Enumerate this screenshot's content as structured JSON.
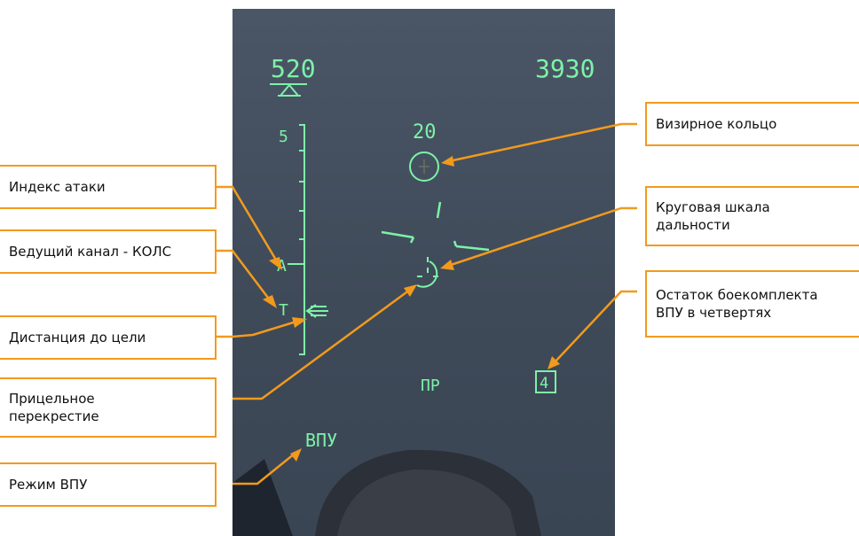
{
  "hud": {
    "speed": "520",
    "altitude": "3930",
    "range_scale_top": "5",
    "ring_value": "20",
    "attack_index_mark": "A",
    "lead_channel_mark": "T",
    "mode_center": "ПР",
    "ammo_quarters": "4",
    "mode_bottom": "ВПУ"
  },
  "callouts": {
    "attack_index": "Индекс атаки",
    "lead_channel": "Ведущий канал - КОЛС",
    "target_distance": "Дистанция до цели",
    "aiming_cross": "Прицельное перекрестие",
    "vpu_mode": "Режим ВПУ",
    "sight_ring": "Визирное кольцо",
    "range_scale": "Круговая шкала дальности",
    "ammo_remaining": "Остаток боекомплекта ВПУ в четвертях"
  },
  "colors": {
    "hud_symbology": "#7df2a8",
    "callout_accent": "#f29a1d"
  }
}
